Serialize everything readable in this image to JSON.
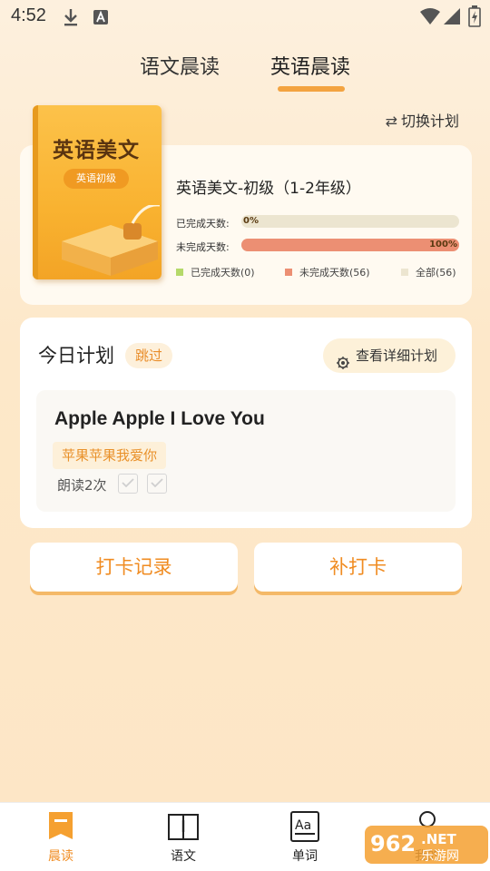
{
  "status_bar": {
    "time": "4:52"
  },
  "tabs": [
    {
      "label": "语文晨读",
      "active": false
    },
    {
      "label": "英语晨读",
      "active": true
    }
  ],
  "switch_plan": {
    "label": "切换计划",
    "icon": "swap-arrows-icon"
  },
  "book": {
    "cover_title": "英语美文",
    "cover_level": "英语初级",
    "plan_name": "英语美文-初级（1-2年级）",
    "completed_label": "已完成天数:",
    "completed_pct_text": "0%",
    "completed_fraction": 0.0,
    "remaining_label": "未完成天数:",
    "remaining_pct_text": "100%",
    "remaining_fraction": 1.0,
    "legend": [
      {
        "label": "已完成天数(0)",
        "color": "#b5d96a"
      },
      {
        "label": "未完成天数(56)",
        "color": "#ec8f73"
      },
      {
        "label": "全部(56)",
        "color": "#ece5d0"
      }
    ]
  },
  "today": {
    "title": "今日计划",
    "skip_label": "跳过",
    "detail_label": "查看详细计划",
    "sentence_en": "Apple Apple I Love You",
    "sentence_cn": "苹果苹果我爱你",
    "read_count": "朗读2次"
  },
  "actions": {
    "checkin_record": "打卡记录",
    "makeup_checkin": "补打卡"
  },
  "bottom_nav": [
    {
      "label": "晨读",
      "icon": "bookmark-icon",
      "active": true
    },
    {
      "label": "语文",
      "icon": "open-book-icon",
      "active": false
    },
    {
      "label": "单词",
      "icon": "dictionary-icon",
      "active": false
    },
    {
      "label": "我的",
      "icon": "profile-icon",
      "active": false
    }
  ],
  "watermark": "962.NET 乐游网",
  "colors": {
    "accent": "#f08c22",
    "completed": "#b5d96a",
    "remaining": "#ec8f73",
    "track": "#ece5d0"
  }
}
